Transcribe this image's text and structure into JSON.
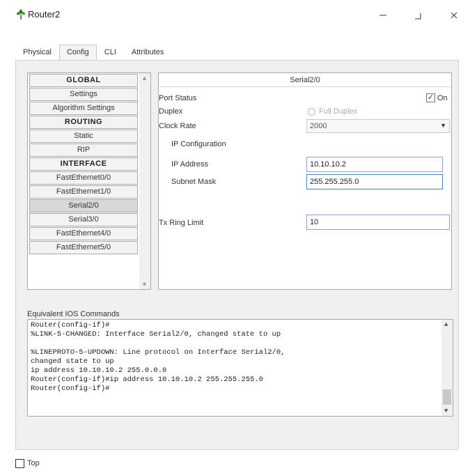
{
  "window": {
    "title": "Router2",
    "icon": "router-plant-icon",
    "minimize": "—",
    "maximize": "⌐",
    "close": "✕"
  },
  "tabs": [
    {
      "label": "Physical"
    },
    {
      "label": "Config",
      "active": true
    },
    {
      "label": "CLI"
    },
    {
      "label": "Attributes"
    }
  ],
  "nav": {
    "items": [
      {
        "label": "GLOBAL",
        "type": "header"
      },
      {
        "label": "Settings"
      },
      {
        "label": "Algorithm Settings"
      },
      {
        "label": "ROUTING",
        "type": "header"
      },
      {
        "label": "Static"
      },
      {
        "label": "RIP"
      },
      {
        "label": "INTERFACE",
        "type": "header"
      },
      {
        "label": "FastEthernet0/0"
      },
      {
        "label": "FastEthernet1/0"
      },
      {
        "label": "Serial2/0",
        "selected": true
      },
      {
        "label": "Serial3/0"
      },
      {
        "label": "FastEthernet4/0"
      },
      {
        "label": "FastEthernet5/0"
      }
    ]
  },
  "config": {
    "title": "Serial2/0",
    "port_status_label": "Port Status",
    "port_status_on_label": "On",
    "port_status_checked": true,
    "duplex_label": "Duplex",
    "duplex_value": "Full Duplex",
    "clock_rate_label": "Clock Rate",
    "clock_rate_value": "2000",
    "ip_config_label": "IP Configuration",
    "ip_address_label": "IP Address",
    "ip_address_value": "10.10.10.2",
    "subnet_mask_label": "Subnet Mask",
    "subnet_mask_value": "255.255.255.0",
    "tx_ring_limit_label": "Tx Ring Limit",
    "tx_ring_limit_value": "10"
  },
  "ios": {
    "label": "Equivalent IOS Commands",
    "lines": [
      "Router(config-if)#",
      "%LINK-5-CHANGED: Interface Serial2/0, changed state to up",
      "",
      "%LINEPROTO-5-UPDOWN: Line protocol on Interface Serial2/0,",
      "changed state to up",
      "ip address 10.10.10.2 255.0.0.0",
      "Router(config-if)#ip address 10.10.10.2 255.255.255.0",
      "Router(config-if)#"
    ]
  },
  "footer": {
    "top_label": "Top",
    "top_checked": false
  }
}
